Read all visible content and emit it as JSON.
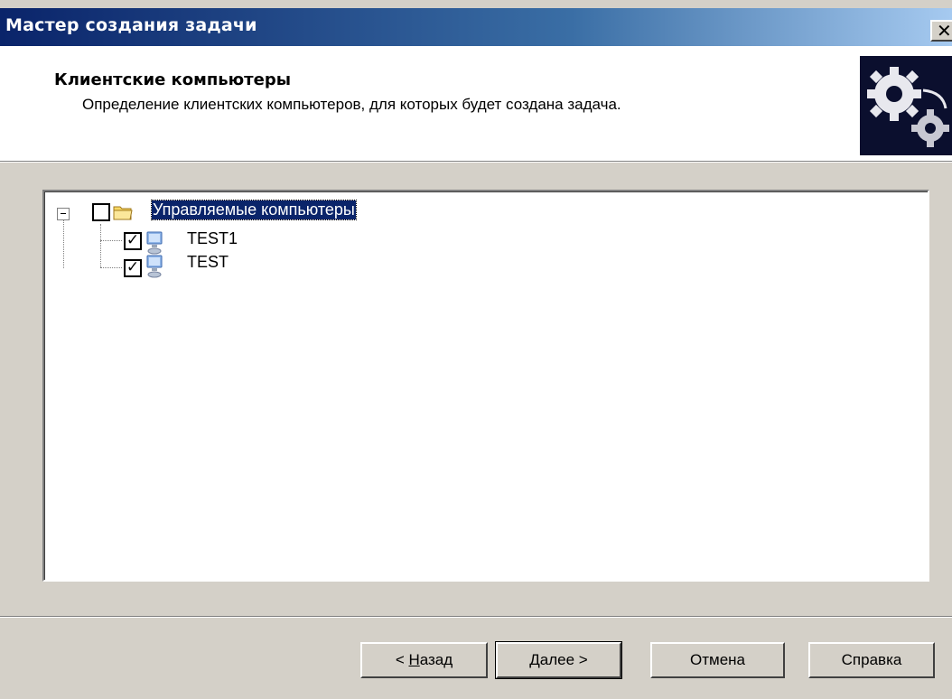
{
  "window": {
    "title": "Мастер создания задачи",
    "close_label": "✕"
  },
  "header": {
    "title": "Клиентские компьютеры",
    "subtitle": "Определение клиентских компьютеров, для которых будет создана задача."
  },
  "tree": {
    "root": {
      "label": "Управляемые компьютеры",
      "checked": false,
      "expanded": true,
      "icon": "folder-icon"
    },
    "children": [
      {
        "label": "TEST1",
        "checked": true,
        "icon": "computer-icon"
      },
      {
        "label": "TEST",
        "checked": true,
        "icon": "computer-icon"
      }
    ]
  },
  "buttons": {
    "back": {
      "prefix": "< ",
      "accel": "Н",
      "rest": "азад"
    },
    "next": {
      "accel": "Д",
      "rest": "алее",
      "suffix": " >"
    },
    "cancel": "Отмена",
    "help": "Справка"
  },
  "colors": {
    "titlebar_start": "#0a246a",
    "titlebar_end": "#a6caf0",
    "face": "#d4d0c8",
    "selection": "#0a246a"
  }
}
